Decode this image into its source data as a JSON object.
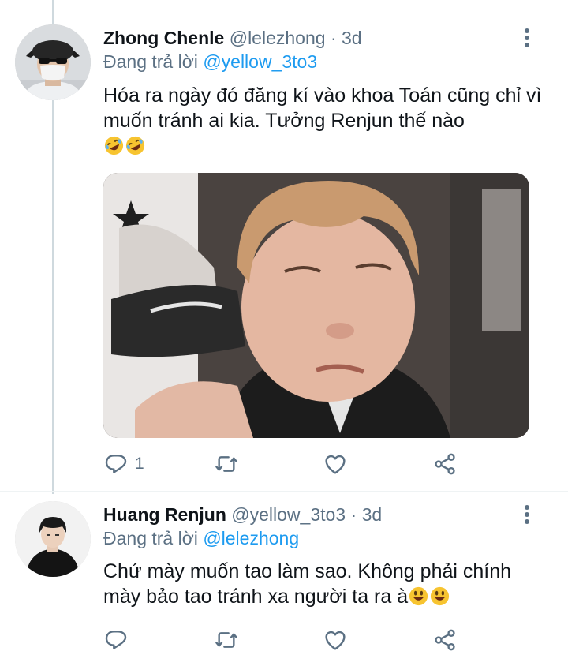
{
  "tweets": [
    {
      "name": "Zhong Chenle",
      "handle": "@lelezhong",
      "dot": "·",
      "time": "3d",
      "replying_prefix": "Đang trả lời",
      "replying_to": "@yellow_3to3",
      "text": "Hóa ra ngày đó đăng kí vào khoa Toán cũng chỉ vì muốn tránh ai kia. Tưởng Renjun thế nào",
      "emojis": [
        "rolling-on-floor-laughing-emoji",
        "rolling-on-floor-laughing-emoji"
      ],
      "reply_count": "1"
    },
    {
      "name": "Huang Renjun",
      "handle": "@yellow_3to3",
      "dot": "·",
      "time": "3d",
      "replying_prefix": "Đang trả lời",
      "replying_to": "@lelezhong",
      "text": "Chứ mày muốn tao làm sao. Không phải chính mày bảo tao tránh xa người ta ra à",
      "emojis": [
        "grinning-face-emoji",
        "grinning-face-emoji"
      ],
      "reply_count": ""
    }
  ],
  "colors": {
    "accent": "#1d9bf0",
    "secondary_text": "#5b7083",
    "thread_line": "#cfd9de"
  },
  "icons": [
    "reply-icon",
    "retweet-icon",
    "like-icon",
    "share-icon",
    "more-icon"
  ]
}
